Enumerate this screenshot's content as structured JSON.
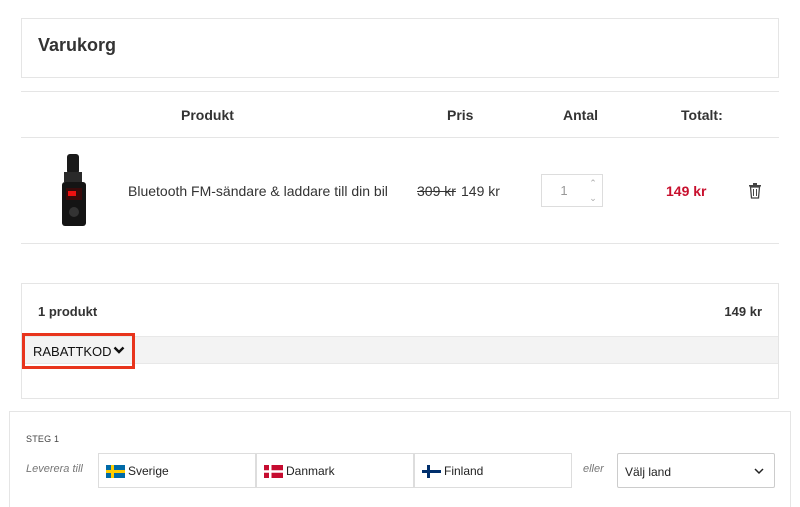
{
  "cart": {
    "title": "Varukorg"
  },
  "table": {
    "headers": {
      "product": "Produkt",
      "price": "Pris",
      "quantity": "Antal",
      "total": "Totalt:"
    }
  },
  "item": {
    "name": "Bluetooth FM-sändare & laddare till din bil",
    "old_price": "309 kr",
    "price": "149 kr",
    "quantity": "1",
    "total": "149 kr"
  },
  "summary": {
    "count": "1 produkt",
    "total": "149 kr",
    "discount_label": "RABATTKOD"
  },
  "shipping": {
    "step": "STEG 1",
    "deliver_to": "Leverera till",
    "countries": [
      "Sverige",
      "Danmark",
      "Finland"
    ],
    "or": "eller",
    "select_label": "Välj land"
  },
  "colors": {
    "price_red": "#c8102e",
    "highlight": "#e8341c"
  }
}
